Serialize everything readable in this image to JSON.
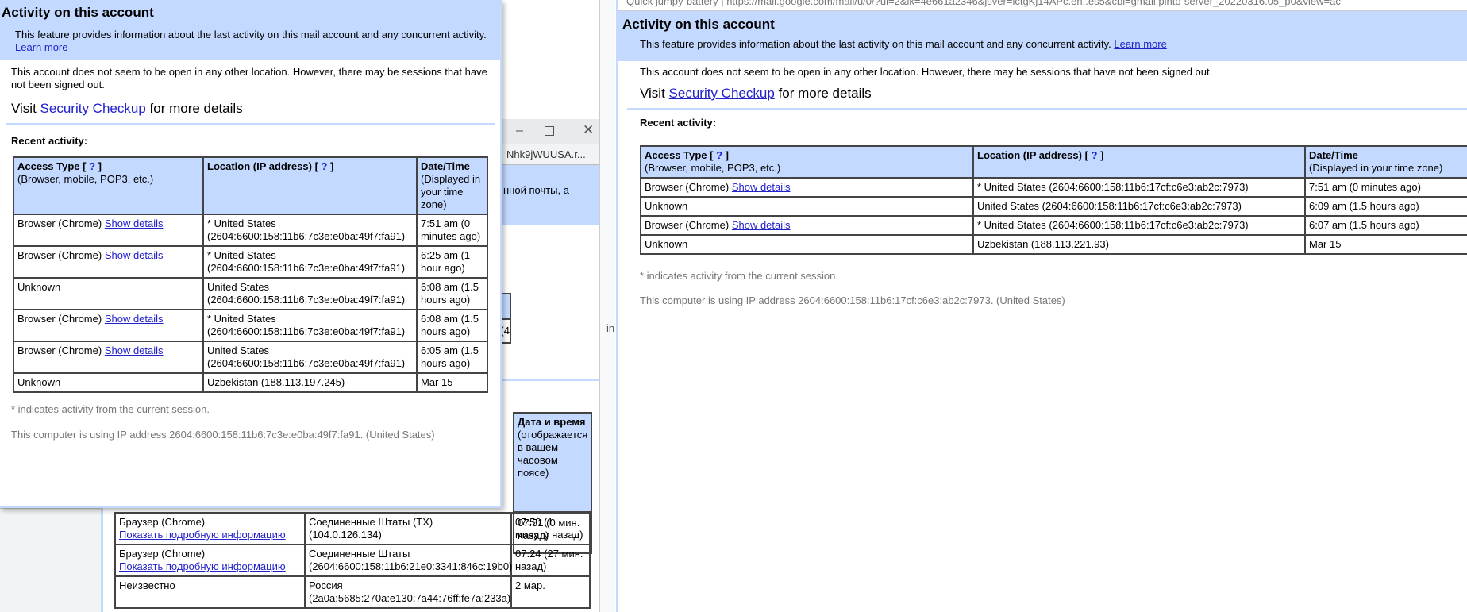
{
  "popup_left": {
    "title": "Activity on this account",
    "intro": "This feature provides information about the last activity on this mail account and any concurrent activity.",
    "learn_more": "Learn more",
    "status": "This account does not seem to be open in any other location. However, there may be sessions that have not been signed out.",
    "visit_prefix": "Visit",
    "security_checkup": "Security Checkup",
    "visit_suffix": "for more details",
    "recent_label": "Recent activity:",
    "headers": {
      "access": "Access Type",
      "access_sub": "(Browser, mobile, POP3, etc.)",
      "location": "Location (IP address)",
      "datetime": "Date/Time",
      "datetime_sub": "(Displayed in your time zone)",
      "help": "?"
    },
    "rows": [
      {
        "type": "Browser (Chrome)",
        "link": "Show details",
        "location": "* United States (2604:6600:158:11b6:7c3e:e0ba:49f7:fa91)",
        "time": "7:51 am (0 minutes ago)"
      },
      {
        "type": "Browser (Chrome)",
        "link": "Show details",
        "location": "* United States (2604:6600:158:11b6:7c3e:e0ba:49f7:fa91)",
        "time": "6:25 am (1 hour ago)"
      },
      {
        "type": "Unknown",
        "link": "",
        "location": "United States (2604:6600:158:11b6:7c3e:e0ba:49f7:fa91)",
        "time": "6:08 am (1.5 hours ago)"
      },
      {
        "type": "Browser (Chrome)",
        "link": "Show details",
        "location": "* United States (2604:6600:158:11b6:7c3e:e0ba:49f7:fa91)",
        "time": "6:08 am (1.5 hours ago)"
      },
      {
        "type": "Browser (Chrome)",
        "link": "Show details",
        "location": "United States (2604:6600:158:11b6:7c3e:e0ba:49f7:fa91)",
        "time": "6:05 am (1.5 hours ago)"
      },
      {
        "type": "Unknown",
        "link": "",
        "location": "Uzbekistan (188.113.197.245)",
        "time": "Mar 15"
      }
    ],
    "footnote": "* indicates activity from the current session.",
    "ip_note": "This computer is using IP address 2604:6600:158:11b6:7c3e:e0ba:49f7:fa91. (United States)"
  },
  "middle_window": {
    "url_fragment": "Nhk9jWUUSA.r...",
    "intro_fragment": "нной почты, а",
    "fragment_cell": "4)",
    "header_datetime": "Дата и время",
    "header_datetime_sub": "(отображается в вашем часовом поясе)",
    "first_time": "07:51 (0 мин. назад)",
    "rows": [
      {
        "type": "Браузер (Chrome)",
        "link": "Показать подробную информацию",
        "location": "Соединенные Штаты (TX) (104.0.126.134)",
        "time": "07:50 (1 минуту назад)"
      },
      {
        "type": "Браузер (Chrome)",
        "link": "Показать подробную информацию",
        "location": "Соединенные Штаты (2604:6600:158:11b6:21e0:3341:846c:19b0)",
        "time": "07:24 (27 мин. назад)"
      },
      {
        "type": "Неизвестно",
        "link": "",
        "location": "Россия (2a0a:5685:270a:e130:7a44:76ff:fe7a:233a)",
        "time": "2 мар."
      }
    ],
    "bg_text": "in"
  },
  "window_right": {
    "tab_title": "Quick jumpy-battery",
    "url": "https://mail.google.com/mail/u/0/?ui=2&ik=4e661a2346&jsver=lctgKj14APc.en..es5&cbl=gmail.pinto-server_20220316.05_p0&view=ac",
    "title": "Activity on this account",
    "intro": "This feature provides information about the last activity on this mail account and any concurrent activity.",
    "learn_more": "Learn more",
    "status": "This account does not seem to be open in any other location. However, there may be sessions that have not been signed out.",
    "visit_prefix": "Visit",
    "security_checkup": "Security Checkup",
    "visit_suffix": "for more details",
    "recent_label": "Recent activity:",
    "headers": {
      "access": "Access Type",
      "access_sub": "(Browser, mobile, POP3, etc.)",
      "location": "Location (IP address)",
      "datetime": "Date/Time",
      "datetime_sub": "(Displayed in your time zone)",
      "help": "?"
    },
    "rows": [
      {
        "type": "Browser (Chrome)",
        "link": "Show details",
        "location": "* United States (2604:6600:158:11b6:17cf:c6e3:ab2c:7973)",
        "time": "7:51 am (0 minutes ago)"
      },
      {
        "type": "Unknown",
        "link": "",
        "location": "United States (2604:6600:158:11b6:17cf:c6e3:ab2c:7973)",
        "time": "6:09 am (1.5 hours ago)"
      },
      {
        "type": "Browser (Chrome)",
        "link": "Show details",
        "location": "* United States (2604:6600:158:11b6:17cf:c6e3:ab2c:7973)",
        "time": "6:07 am (1.5 hours ago)"
      },
      {
        "type": "Unknown",
        "link": "",
        "location": "Uzbekistan (188.113.221.93)",
        "time": "Mar 15"
      }
    ],
    "footnote": "* indicates activity from the current session.",
    "ip_note": "This computer is using IP address 2604:6600:158:11b6:17cf:c6e3:ab2c:7973. (United States)"
  },
  "colors": {
    "header_blue": "#c3d9ff",
    "link": "#2222cc",
    "muted": "#777777"
  }
}
